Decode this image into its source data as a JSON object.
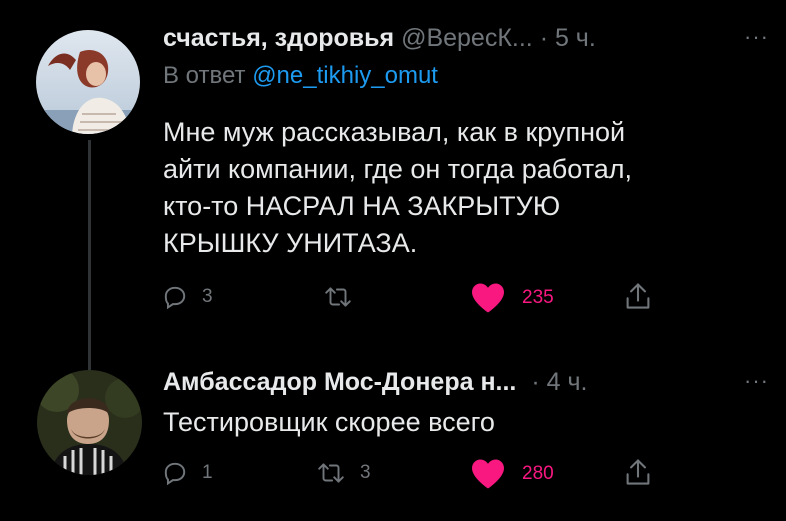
{
  "tweets": [
    {
      "name": "счастья, здоровья",
      "handle": "@ВересК...",
      "time": "· 5 ч.",
      "reply_prefix": "В ответ",
      "reply_handle": "@ne_tikhiy_omut",
      "text_lines": [
        "Мне муж рассказывал, как в крупной",
        "айти компании, где он тогда работал,",
        "кто-то НАСРАЛ НА ЗАКРЫТУЮ",
        "КРЫШКУ УНИТАЗА."
      ],
      "replies": "3",
      "retweets": "",
      "likes": "235"
    },
    {
      "name": "Амбассадор Мос-Донера н...",
      "time": "· 4 ч.",
      "text": "Тестировщик скорее всего",
      "replies": "1",
      "retweets": "3",
      "likes": "280"
    }
  ],
  "more_glyph": "···",
  "icons": {
    "reply": "reply-icon",
    "retweet": "retweet-icon",
    "like": "heart-icon",
    "share": "share-icon",
    "more": "more-icon"
  },
  "colors": {
    "background": "#000000",
    "text": "#e7e9ea",
    "muted": "#71767b",
    "link": "#1d9bf0",
    "like": "#f91880"
  }
}
